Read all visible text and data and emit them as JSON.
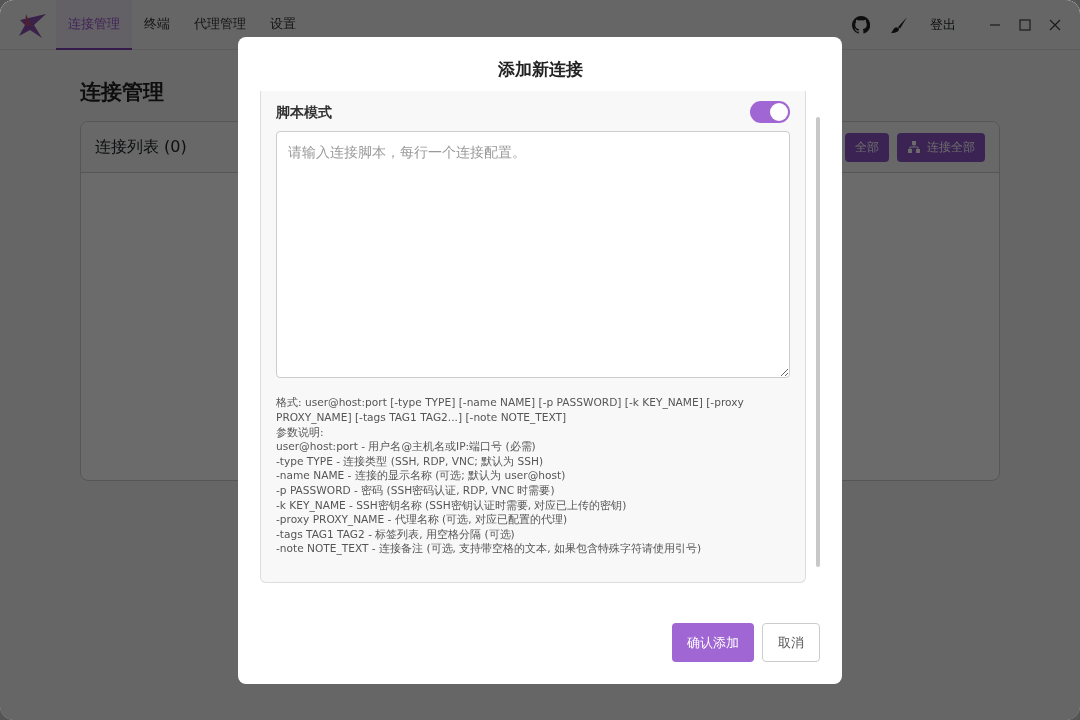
{
  "nav": {
    "tabs": [
      {
        "label": "连接管理",
        "selected": true
      },
      {
        "label": "终端",
        "selected": false
      },
      {
        "label": "代理管理",
        "selected": false
      },
      {
        "label": "设置",
        "selected": false
      }
    ],
    "logout": "登出"
  },
  "page": {
    "title": "连接管理",
    "card_title": "连接列表 (0)",
    "buttons": [
      {
        "label": "全部",
        "kind": "partial"
      },
      {
        "label": "连接全部",
        "kind": "connect"
      }
    ]
  },
  "dialog": {
    "title": "添加新连接",
    "script_mode": {
      "label": "脚本模式",
      "on": true
    },
    "script": {
      "placeholder": "请输入连接脚本，每行一个连接配置。"
    },
    "help": [
      "格式: user@host:port [-type TYPE] [-name NAME] [-p PASSWORD] [-k KEY_NAME] [-proxy PROXY_NAME] [-tags TAG1 TAG2...] [-note NOTE_TEXT]",
      "参数说明:",
      "user@host:port - 用户名@主机名或IP:端口号 (必需)",
      "-type TYPE - 连接类型 (SSH, RDP, VNC; 默认为 SSH)",
      "-name NAME - 连接的显示名称 (可选; 默认为 user@host)",
      "-p PASSWORD - 密码 (SSH密码认证, RDP, VNC 时需要)",
      "-k KEY_NAME - SSH密钥名称 (SSH密钥认证时需要, 对应已上传的密钥)",
      "-proxy PROXY_NAME - 代理名称 (可选, 对应已配置的代理)",
      "-tags TAG1 TAG2 - 标签列表, 用空格分隔 (可选)",
      "-note NOTE_TEXT - 连接备注 (可选, 支持带空格的文本, 如果包含特殊字符请使用引号)"
    ],
    "confirm": "确认添加",
    "cancel": "取消"
  }
}
